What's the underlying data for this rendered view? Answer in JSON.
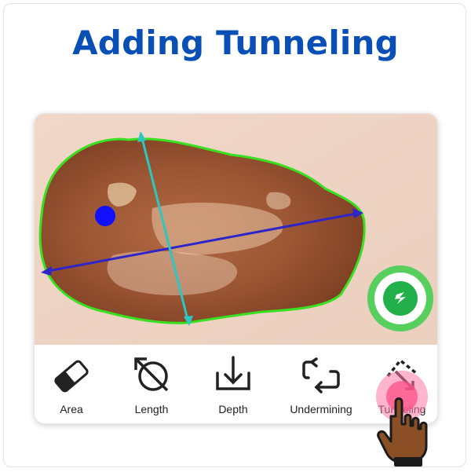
{
  "title": "Adding Tunneling",
  "toolbar": {
    "items": [
      {
        "label": "Area",
        "icon": "eraser-icon"
      },
      {
        "label": "Length",
        "icon": "length-measure-icon"
      },
      {
        "label": "Depth",
        "icon": "depth-icon"
      },
      {
        "label": "Undermining",
        "icon": "undermining-icon"
      },
      {
        "label": "Tunneling",
        "icon": "tunneling-icon"
      }
    ]
  },
  "colors": {
    "title": "#0a4fb5",
    "outline": "#39e01f",
    "length_line": "#2e25c9",
    "width_line": "#2bc7c0",
    "marker": "#1010ff",
    "fab": "#22b04a",
    "touch": "#ff4f88"
  }
}
